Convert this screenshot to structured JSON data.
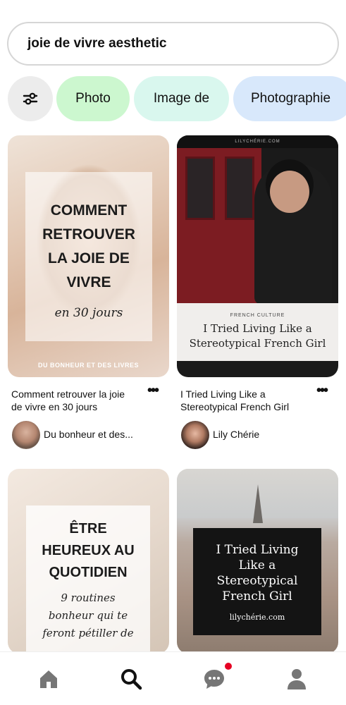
{
  "search": {
    "query": "joie de vivre aesthetic"
  },
  "filters": {
    "icon": "sliders-icon",
    "chips": [
      "Photo",
      "Image de",
      "Photographie"
    ],
    "chip_colors": [
      "#ccf7cf",
      "#d9f7ee",
      "#d8e8fb"
    ]
  },
  "pins": [
    {
      "overlay_title": "COMMENT\nRETROUVER\nLA JOIE DE\nVIVRE",
      "overlay_subtitle": "en 30 jours",
      "overlay_footer": "DU BONHEUR ET DES LIVRES",
      "caption": "Comment retrouver la joie\nde vivre en 30 jours",
      "author": "Du bonheur et des..."
    },
    {
      "overlay_top": "LILYCHÉRIE.COM",
      "overlay_kicker": "FRENCH CULTURE",
      "overlay_title": "I Tried Living Like a\nStereotypical French Girl",
      "caption": "I Tried Living Like a\nStereotypical French Girl",
      "author": "Lily Chérie"
    },
    {
      "overlay_title": "ÊTRE\nHEUREUX AU\nQUOTIDIEN",
      "overlay_subtitle": "9 routines\nbonheur qui te\nferont pétiller de"
    },
    {
      "overlay_title": "I Tried Living\nLike a\nStereotypical\nFrench Girl",
      "overlay_url": "lilychérie.com"
    }
  ],
  "more_label": "•••",
  "nav": {
    "items": [
      "home-icon",
      "search-icon",
      "messages-icon",
      "profile-icon"
    ],
    "active": "search-icon",
    "badge_color": "#e60023"
  }
}
